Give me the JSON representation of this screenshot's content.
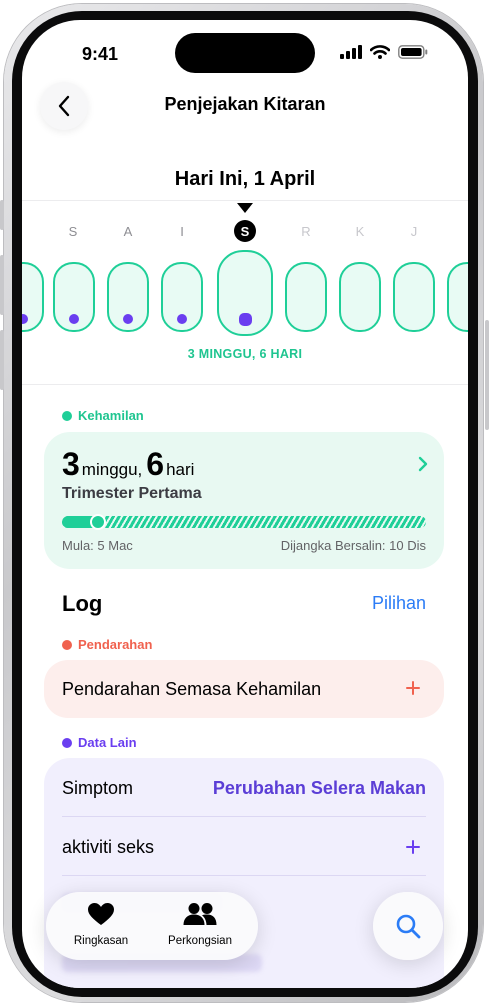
{
  "status_bar": {
    "time": "9:41"
  },
  "nav": {
    "title": "Penjejakan Kitaran"
  },
  "date_header": "Hari Ini, 1 April",
  "calendar": {
    "days": [
      "S",
      "A",
      "I",
      "S",
      "R",
      "K",
      "J"
    ],
    "today_index": 3,
    "weeks_label": "3 MINGGU, 6 HARI"
  },
  "pregnancy": {
    "section_label": "Kehamilan",
    "weeks_value": "3",
    "weeks_unit": "minggu,",
    "days_value": "6",
    "days_unit": "hari",
    "trimester": "Trimester Pertama",
    "progress_fraction": 0.1,
    "start_text": "Mula: 5 Mac",
    "due_text": "Dijangka Bersalin: 10 Dis"
  },
  "log": {
    "title": "Log",
    "options_label": "Pilihan"
  },
  "bleeding": {
    "section_label": "Pendarahan",
    "row_label": "Pendarahan Semasa Kehamilan"
  },
  "other_data": {
    "section_label": "Data Lain",
    "symptom_label": "Simptom",
    "symptom_value": "Perubahan Selera Makan",
    "sex_label": "aktiviti seks"
  },
  "tabbar": {
    "summary_label": "Ringkasan",
    "sharing_label": "Perkongsian"
  },
  "colors": {
    "green": "#1fcf98",
    "purple": "#6a3ef0",
    "red": "#f0614e",
    "blue": "#2b7cf6"
  }
}
